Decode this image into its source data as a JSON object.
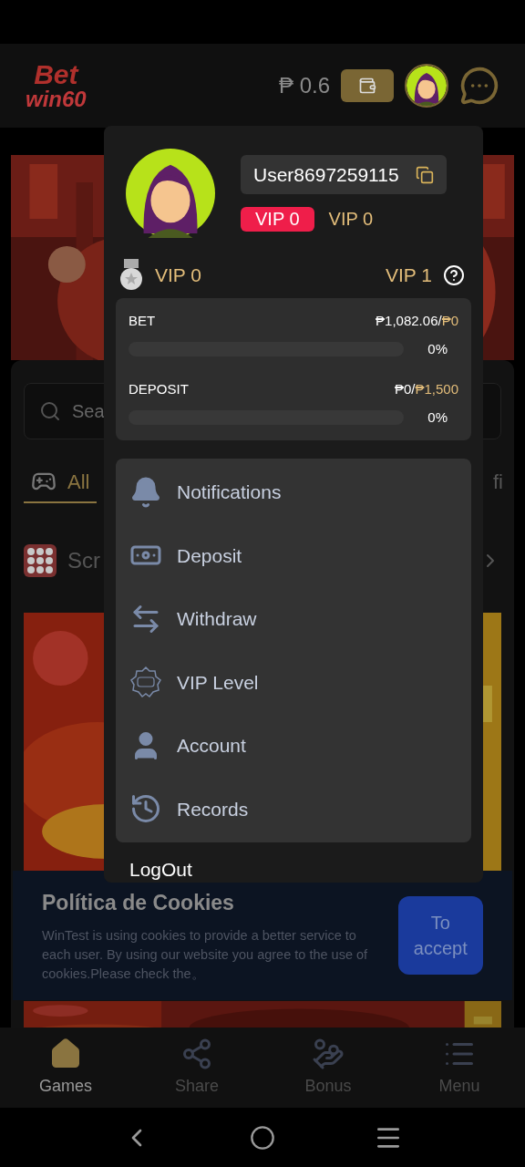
{
  "header": {
    "logo_top": "Bet",
    "logo_bottom": "win60",
    "balance": "₱ 0.6"
  },
  "search": {
    "placeholder": "Sea"
  },
  "tabs": [
    {
      "label": "All",
      "selected": true
    },
    {
      "label": "fi",
      "selected": false
    }
  ],
  "section": {
    "title": "Scr"
  },
  "profile_menu": {
    "username": "User8697259115",
    "vip_badge": "VIP 0",
    "vip_label": "VIP 0",
    "current_level": "VIP 0",
    "next_level": "VIP 1",
    "progress": [
      {
        "label": "BET",
        "amount": "₱1,082.06/",
        "target": "₱0",
        "level": 0,
        "percent": "0%"
      },
      {
        "label": "DEPOSIT",
        "amount": "₱0/",
        "target": "₱1,500",
        "level": 0,
        "percent": "0%"
      }
    ],
    "items": [
      {
        "label": "Notifications",
        "kind": "bell"
      },
      {
        "label": "Deposit",
        "kind": "deposit"
      },
      {
        "label": "Withdraw",
        "kind": "withdraw"
      },
      {
        "label": "VIP Level",
        "kind": "vip"
      },
      {
        "label": "Account",
        "kind": "user"
      },
      {
        "label": "Records",
        "kind": "history"
      }
    ],
    "logout": "LogOut"
  },
  "cookie_banner": {
    "title": "Política de Cookies",
    "text": "WinTest is using cookies to provide a better service to each user. By using our website you agree to the use of cookies.Please check the。",
    "button": "To accept"
  },
  "bottom_nav": [
    {
      "label": "Games",
      "kind": "home",
      "selected": true
    },
    {
      "label": "Share",
      "kind": "share",
      "selected": false
    },
    {
      "label": "Bonus",
      "kind": "bonus",
      "selected": false
    },
    {
      "label": "Menu",
      "kind": "menu",
      "selected": false
    }
  ]
}
